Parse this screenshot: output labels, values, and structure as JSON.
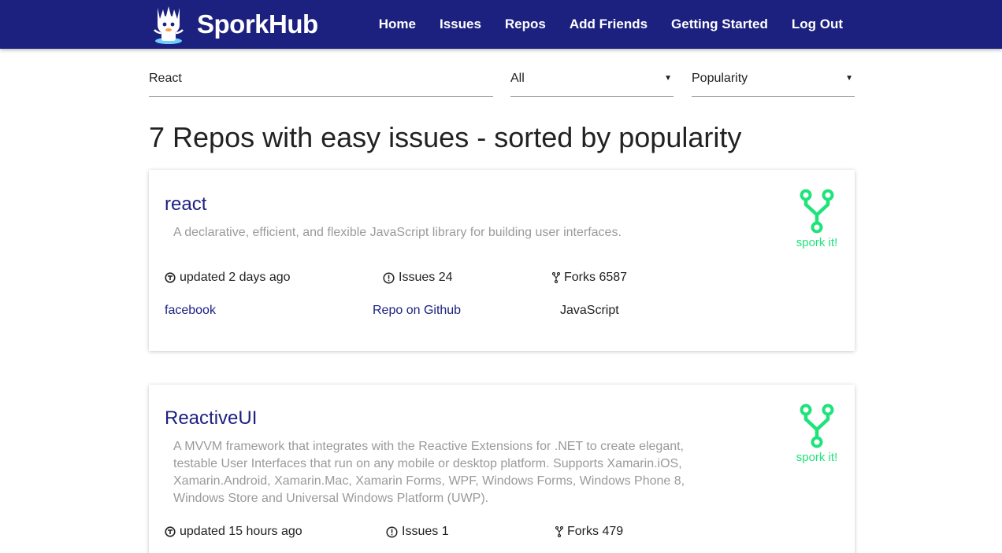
{
  "brand": {
    "name": "SporkHub"
  },
  "nav": [
    "Home",
    "Issues",
    "Repos",
    "Add Friends",
    "Getting Started",
    "Log Out"
  ],
  "filters": {
    "search_value": "React",
    "language": "All",
    "sort": "Popularity"
  },
  "heading": "7 Repos with easy issues - sorted by popularity",
  "repos": [
    {
      "name": "react",
      "description": "A declarative, efficient, and flexible JavaScript library for building user interfaces.",
      "updated": "updated 2 days ago",
      "issues": "Issues 24",
      "forks": "Forks 6587",
      "owner": "facebook",
      "github_link": "Repo on Github",
      "language": "JavaScript",
      "spork_label": "spork it!"
    },
    {
      "name": "ReactiveUI",
      "description": "A MVVM framework that integrates with the Reactive Extensions for .NET to create elegant, testable User Interfaces that run on any mobile or desktop platform. Supports Xamarin.iOS, Xamarin.Android, Xamarin.Mac, Xamarin Forms, WPF, Windows Forms, Windows Phone 8, Windows Store and Universal Windows Platform (UWP).",
      "updated": "updated 15 hours ago",
      "issues": "Issues 1",
      "forks": "Forks 479",
      "spork_label": "spork it!"
    }
  ],
  "colors": {
    "header": "#1c2180",
    "accent": "#1ee37a",
    "link": "#1c2180",
    "muted": "#9a9a9a"
  },
  "icons": {
    "updated": "repo-update-icon",
    "issues": "issue-icon",
    "forks": "fork-icon",
    "spork": "spork-fork-icon"
  }
}
